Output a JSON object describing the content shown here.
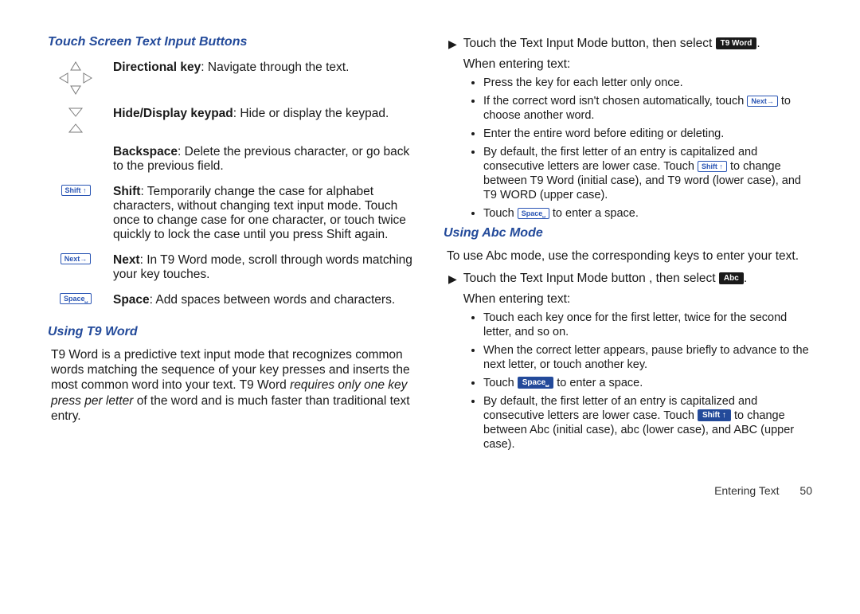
{
  "footer": {
    "section": "Entering Text",
    "page": "50"
  },
  "left": {
    "h1": "Touch Screen Text Input Buttons",
    "rows": [
      {
        "bold": "Directional key",
        "text": ": Navigate through the text."
      },
      {
        "bold": "Hide/Display keypad",
        "text": ": Hide or display the keypad."
      },
      {
        "bold": "Backspace",
        "text": ": Delete the previous character, or go back to the previous field."
      },
      {
        "bold": "Shift",
        "text": ": Temporarily change the case for alphabet characters, without changing text input mode. Touch once to change case for one character, or touch twice quickly to lock  the case until you press Shift again."
      },
      {
        "bold": "Next",
        "text": ": In T9 Word mode, scroll through words matching your key touches."
      },
      {
        "bold": "Space",
        "text": ": Add spaces between words and characters."
      }
    ],
    "h2": "Using T9 Word",
    "p_pre": "T9 Word is a predictive text input mode that recognizes common words matching the sequence of your key presses and inserts the most common word into your text.  T9 Word ",
    "p_em": "requires only one key press per letter",
    "p_post": " of the word and is much faster than traditional text entry.",
    "keys": {
      "shift": "Shift ↑",
      "next": "Next→",
      "space": "Space⎵"
    }
  },
  "right": {
    "line1_pre": "Touch the Text Input Mode button, then select ",
    "line1_btn": "T9 Word",
    "line1_post": ".",
    "line2": "When entering text:",
    "bullets1": {
      "b1": "Press the key for each letter only once.",
      "b2_pre": "If the correct word isn't chosen automatically, touch  ",
      "b2_btn": "Next→",
      "b2_post": "  to choose another word.",
      "b3": "Enter the entire word before editing or deleting.",
      "b4_pre": "By default, the first letter of an entry is capitalized and consecutive letters are lower case. Touch  ",
      "b4_btn": "Shift ↑",
      "b4_post": "  to change between T9 Word (initial case), and T9 word (lower case), and T9 WORD (upper case).",
      "b5_pre": "Touch  ",
      "b5_btn": "Space⎵",
      "b5_post": "  to enter a space."
    },
    "h2": "Using Abc Mode",
    "intro": "To use Abc mode, use the corresponding keys to enter your text.",
    "line3_pre": "Touch the Text Input Mode button , then select  ",
    "line3_btn": "Abc",
    "line3_post": ".",
    "line4": "When entering text:",
    "bullets2": {
      "b1": "Touch each key once for the first letter, twice for the second letter, and so on.",
      "b2": "When the correct letter appears, pause briefly to advance to the next letter, or touch another key.",
      "b3_pre": "Touch  ",
      "b3_btn": "Space⎵",
      "b3_post": "  to enter a space.",
      "b4_pre": "By default, the first letter of an entry is capitalized and consecutive letters are lower case. Touch  ",
      "b4_btn": "Shift ↑",
      "b4_post": "  to change between Abc (initial case), abc (lower case), and ABC (upper case)."
    }
  }
}
